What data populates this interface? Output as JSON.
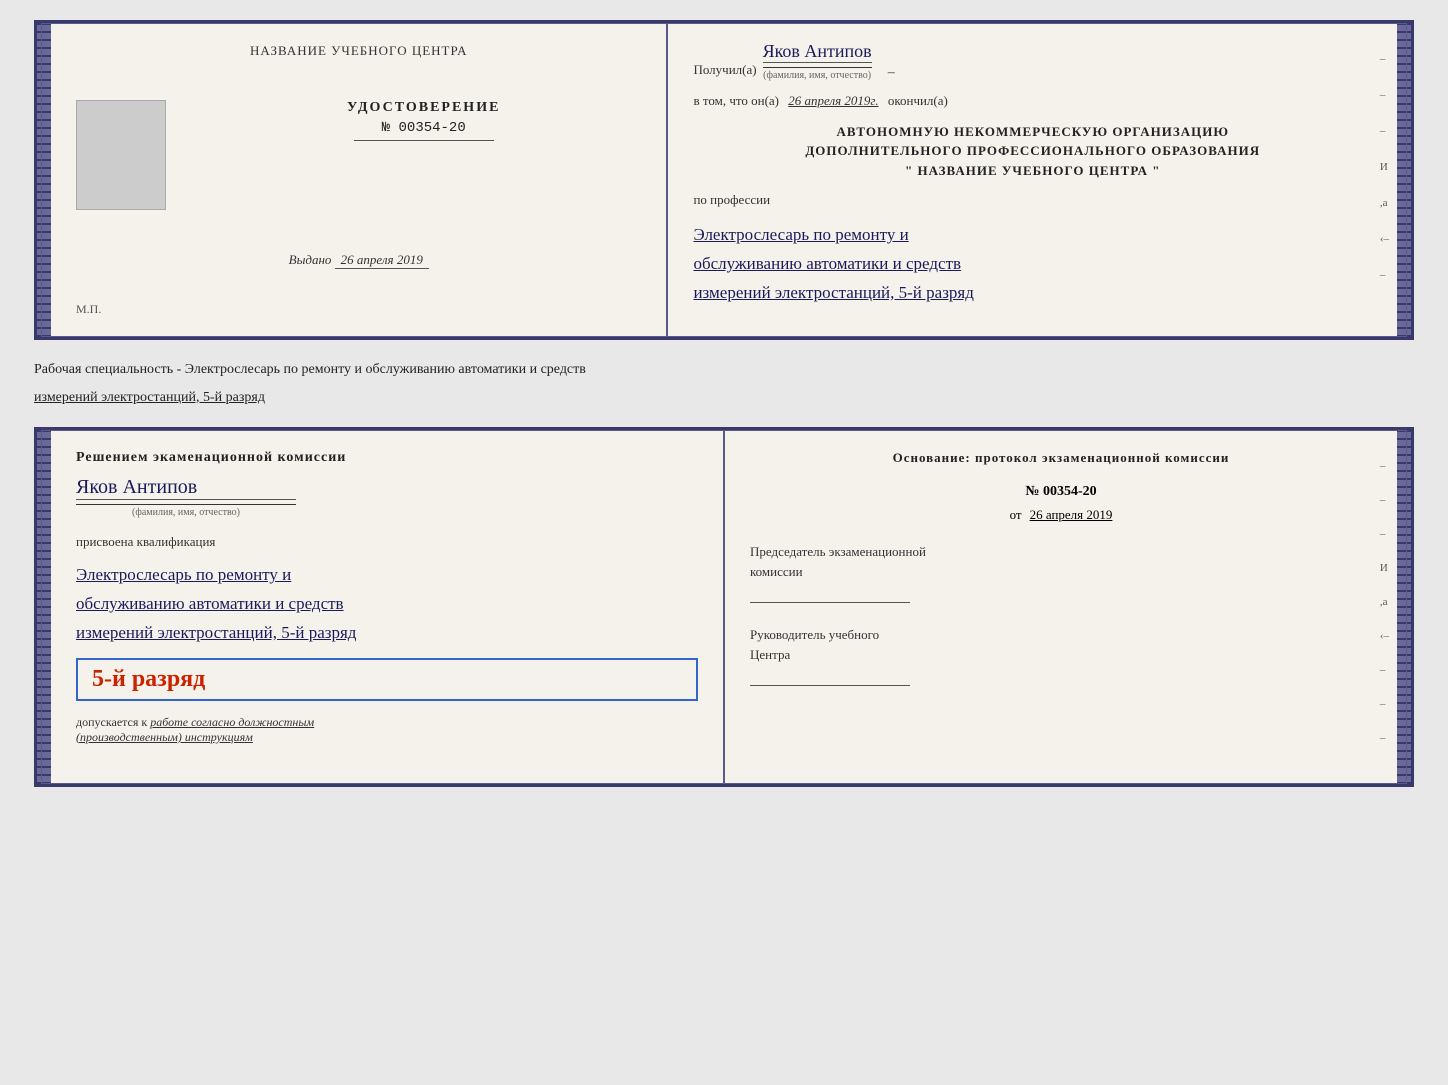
{
  "top_booklet": {
    "left": {
      "org_name": "НАЗВАНИЕ УЧЕБНОГО ЦЕНТРА",
      "cert_title": "УДОСТОВЕРЕНИЕ",
      "cert_number": "№ 00354-20",
      "issued_label": "Выдано",
      "issued_date": "26 апреля 2019",
      "stamp_label": "М.П."
    },
    "right": {
      "recipient_prefix": "Получил(а)",
      "recipient_name": "Яков Антипов",
      "recipient_sublabel": "(фамилия, имя, отчество)",
      "date_prefix": "в том, что он(а)",
      "date_value": "26 апреля 2019г.",
      "date_suffix": "окончил(а)",
      "org_text1": "АВТОНОМНУЮ НЕКОММЕРЧЕСКУЮ ОРГАНИЗАЦИЮ",
      "org_text2": "ДОПОЛНИТЕЛЬНОГО ПРОФЕССИОНАЛЬНОГО ОБРАЗОВАНИЯ",
      "org_text3": "\"  НАЗВАНИЕ УЧЕБНОГО ЦЕНТРА  \"",
      "profession_prefix": "по профессии",
      "profession_line1": "Электрослесарь по ремонту и",
      "profession_line2": "обслуживанию автоматики и средств",
      "profession_line3": "измерений электростанций, 5-й разряд",
      "edge_marks": [
        "–",
        "–",
        "–",
        "И",
        ",а",
        "‹–",
        "–",
        "–"
      ]
    }
  },
  "middle_text": {
    "line1": "Рабочая специальность - Электрослесарь по ремонту и обслуживанию автоматики и средств",
    "line2": "измерений электростанций, 5-й разряд"
  },
  "bottom_booklet": {
    "left": {
      "decision_text": "Решением экаменационной комиссии",
      "person_name": "Яков Антипов",
      "person_sublabel": "(фамилия, имя, отчество)",
      "assigned_label": "присвоена квалификация",
      "qualification_line1": "Электрослесарь по ремонту и",
      "qualification_line2": "обслуживанию автоматики и средств",
      "qualification_line3": "измерений электростанций, 5-й разряд",
      "badge_text": "5-й разряд",
      "allowed_prefix": "допускается к",
      "allowed_text": "работе согласно должностным",
      "allowed_text2": "(производственным) инструкциям"
    },
    "right": {
      "basis_label": "Основание: протокол экзаменационной комиссии",
      "protocol_number": "№  00354-20",
      "date_prefix": "от",
      "date_value": "26 апреля 2019",
      "chairman_label1": "Председатель экзаменационной",
      "chairman_label2": "комиссии",
      "director_label1": "Руководитель учебного",
      "director_label2": "Центра",
      "edge_marks": [
        "–",
        "–",
        "–",
        "И",
        ",а",
        "‹–",
        "–",
        "–",
        "–"
      ]
    }
  }
}
